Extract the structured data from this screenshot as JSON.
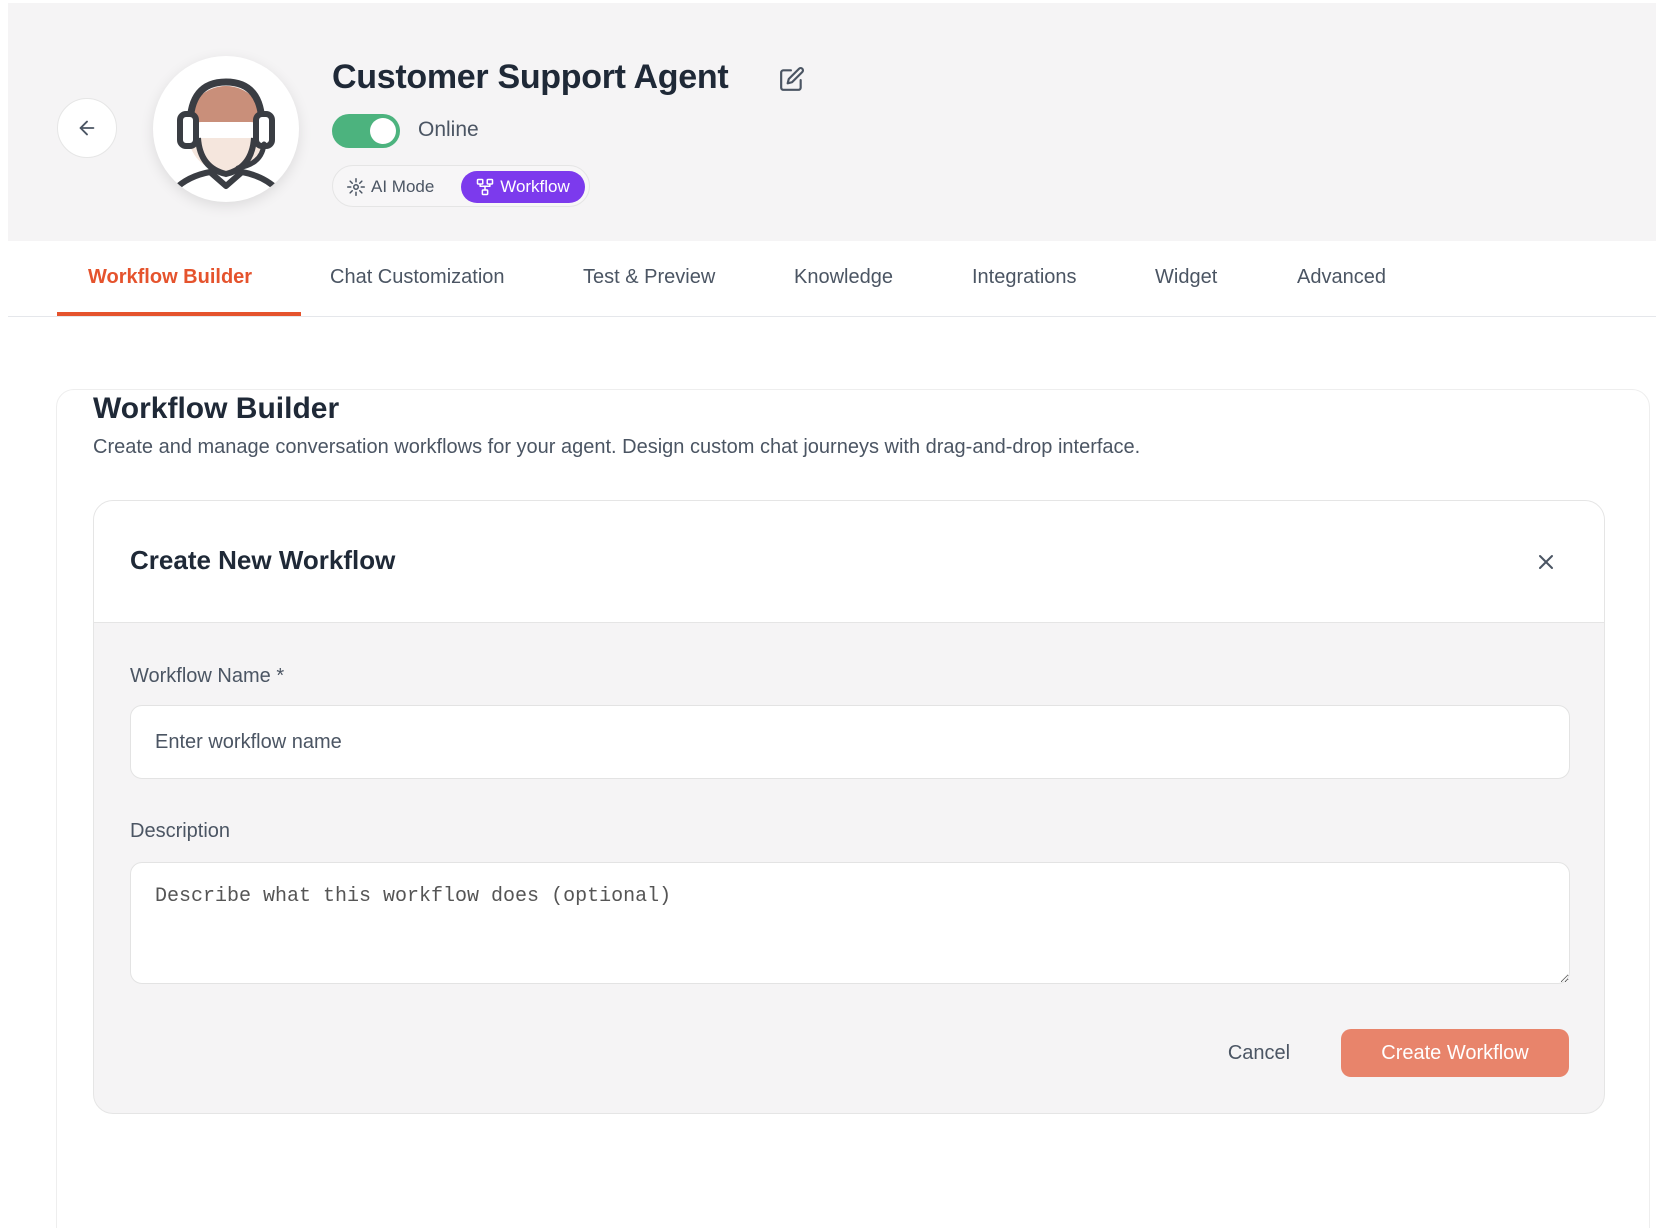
{
  "header": {
    "agent_name": "Customer Support Agent",
    "status": "Online",
    "status_on": true,
    "modes": {
      "ai_label": "AI Mode",
      "workflow_label": "Workflow",
      "active": "Workflow"
    }
  },
  "tabs": [
    {
      "label": "Workflow Builder",
      "active": true
    },
    {
      "label": "Chat Customization",
      "active": false
    },
    {
      "label": "Test & Preview",
      "active": false
    },
    {
      "label": "Knowledge",
      "active": false
    },
    {
      "label": "Integrations",
      "active": false
    },
    {
      "label": "Widget",
      "active": false
    },
    {
      "label": "Advanced",
      "active": false
    }
  ],
  "section": {
    "title": "Workflow Builder",
    "description": "Create and manage conversation workflows for your agent. Design custom chat journeys with drag-and-drop interface."
  },
  "form": {
    "title": "Create New Workflow",
    "name_label": "Workflow Name *",
    "name_placeholder": "Enter workflow name",
    "name_value": "",
    "description_label": "Description",
    "description_placeholder": "Describe what this workflow does (optional)",
    "description_value": "",
    "cancel_label": "Cancel",
    "submit_label": "Create Workflow"
  },
  "icons": {
    "back": "arrow-left-icon",
    "edit": "edit-icon",
    "ai_mode": "sparkle-icon",
    "workflow": "workflow-icon",
    "close": "close-icon",
    "avatar": "headset-agent-icon"
  },
  "colors": {
    "accent": "#e5532d",
    "primary_button": "#e8846b",
    "toggle_on": "#4cb37e",
    "workflow_pill": "#7c3aed",
    "header_bg": "#f5f4f5"
  }
}
